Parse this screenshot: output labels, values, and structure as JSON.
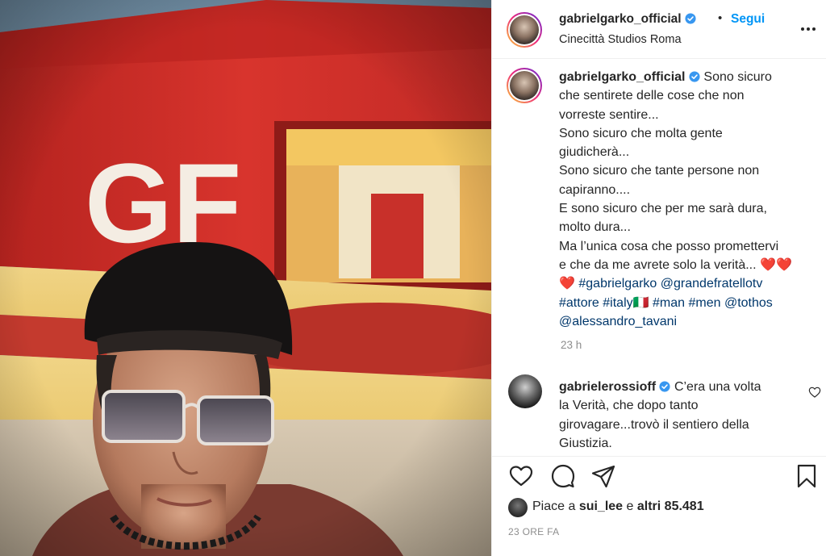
{
  "post": {
    "image_alt": "Selfie in front of red GF building",
    "sign_text": "GF"
  },
  "header": {
    "username": "gabrielgarko_official",
    "separator": "•",
    "follow_label": "Segui",
    "location": "Cinecittà Studios Roma",
    "more_icon": "more-horizontal-icon"
  },
  "caption": {
    "username": "gabrielgarko_official",
    "lines": [
      "Sono sicuro",
      "che sentirete delle cose che non",
      "vorreste sentire...",
      "Sono sicuro che molta gente",
      "giudicherà...",
      "Sono sicuro che tante persone non",
      "capiranno....",
      "E sono sicuro che per me sarà dura,",
      "molto dura...",
      "Ma l’unica cosa che posso promettervi",
      "e che da me avrete solo la verità... ❤️❤️"
    ],
    "heart": "❤️",
    "tags_line1": [
      "#gabrielgarko",
      "@grandefratellotv"
    ],
    "tags_line2_a": "#attore",
    "tags_line2_b": "#italy🇮🇹",
    "tags_line2_c": [
      "#man",
      "#men",
      "@tothos"
    ],
    "tags_line3": "@alessandro_tavani",
    "time": "23 h"
  },
  "comment": {
    "username": "gabrielerossioff",
    "lines": [
      "C’era una volta",
      "la Verità, che dopo tanto",
      "girovagare...trovò il sentiero della",
      "Giustizia."
    ]
  },
  "actions": {
    "like_icon": "heart-icon",
    "comment_icon": "comment-icon",
    "share_icon": "paper-plane-icon",
    "save_icon": "bookmark-icon"
  },
  "likes": {
    "prefix": "Piace a ",
    "user": "sui_lee",
    "middle": " e ",
    "others": "altri 85.481"
  },
  "date": "23 ORE FA",
  "colors": {
    "link_blue": "#00376b",
    "follow_blue": "#0095f6",
    "secondary": "#8e8e8e",
    "verified": "#3897f0"
  }
}
